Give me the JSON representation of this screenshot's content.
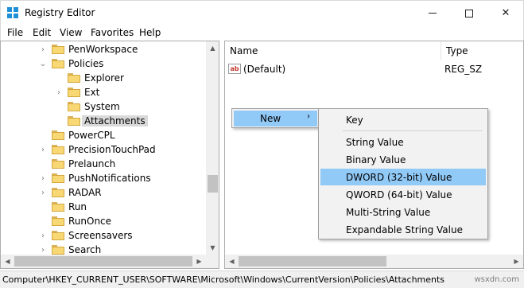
{
  "window": {
    "title": "Registry Editor",
    "controls": {
      "minimize": "minimize",
      "maximize": "maximize",
      "close": "✕"
    }
  },
  "menu": [
    "File",
    "Edit",
    "View",
    "Favorites",
    "Help"
  ],
  "tree": [
    {
      "label": "PenWorkspace",
      "expander": "›"
    },
    {
      "label": "Policies",
      "expander": "⌄"
    },
    {
      "label": "Explorer",
      "expander": ""
    },
    {
      "label": "Ext",
      "expander": "›"
    },
    {
      "label": "System",
      "expander": ""
    },
    {
      "label": "Attachments",
      "expander": "",
      "selected": true
    },
    {
      "label": "PowerCPL",
      "expander": ""
    },
    {
      "label": "PrecisionTouchPad",
      "expander": "›"
    },
    {
      "label": "Prelaunch",
      "expander": ""
    },
    {
      "label": "PushNotifications",
      "expander": "›"
    },
    {
      "label": "RADAR",
      "expander": "›"
    },
    {
      "label": "Run",
      "expander": ""
    },
    {
      "label": "RunOnce",
      "expander": ""
    },
    {
      "label": "Screensavers",
      "expander": "›"
    },
    {
      "label": "Search",
      "expander": "›"
    }
  ],
  "list": {
    "columns": [
      "Name",
      "Type"
    ],
    "rows": [
      {
        "icon": "ab",
        "name": "(Default)",
        "type": "REG_SZ"
      }
    ]
  },
  "context_menu": {
    "new_label": "New",
    "new_arrow": "›",
    "submenu": [
      "Key",
      "String Value",
      "Binary Value",
      "DWORD (32-bit) Value",
      "QWORD (64-bit) Value",
      "Multi-String Value",
      "Expandable String Value"
    ],
    "highlighted": "DWORD (32-bit) Value"
  },
  "statusbar": {
    "path": "Computer\\HKEY_CURRENT_USER\\SOFTWARE\\Microsoft\\Windows\\CurrentVersion\\Policies\\Attachments",
    "watermark": "wsxdn.com"
  },
  "colors": {
    "highlight": "#91c9f7",
    "selection": "#d9d9d9",
    "folder": "#f8d775",
    "app_icon": "#1e90d8"
  }
}
